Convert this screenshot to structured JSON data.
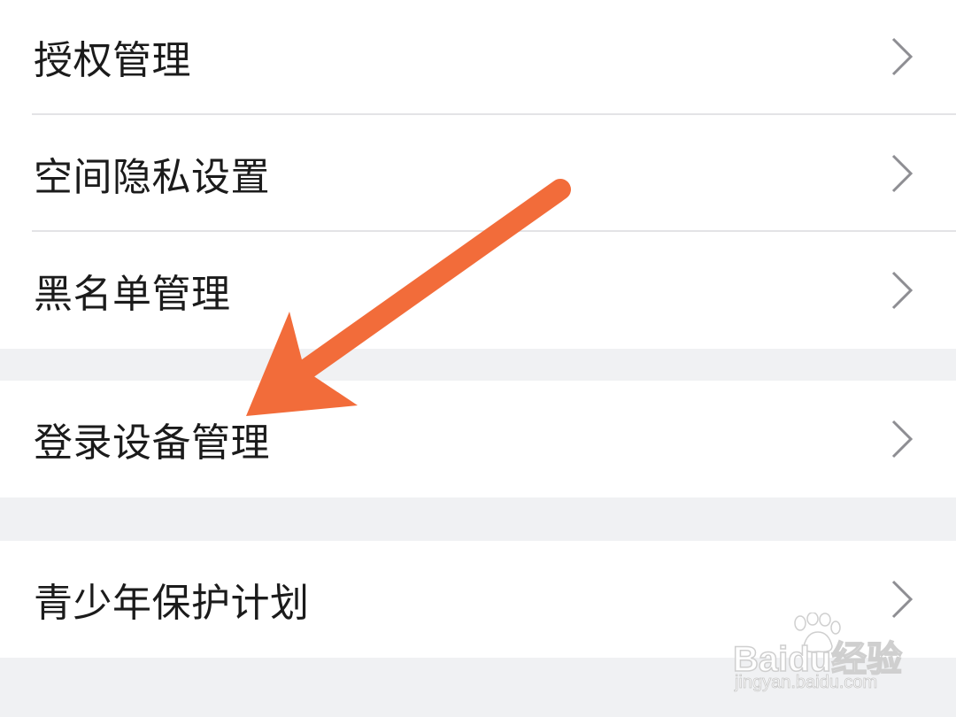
{
  "settings_groups": [
    {
      "items": [
        {
          "label": "授权管理"
        },
        {
          "label": "空间隐私设置"
        },
        {
          "label": "黑名单管理"
        }
      ]
    },
    {
      "items": [
        {
          "label": "登录设备管理"
        }
      ]
    },
    {
      "items": [
        {
          "label": "青少年保护计划"
        }
      ]
    }
  ],
  "colors": {
    "background": "#f0f1f3",
    "row_background": "#ffffff",
    "text": "#1b1b1b",
    "chevron": "#8e8e93",
    "divider": "#e3e3e6",
    "annotation_arrow": "#f26c3a"
  },
  "icons": {
    "row_chevron": "chevron-right-icon",
    "annotation": "arrow-annotation-icon"
  },
  "watermark": {
    "brand": "Baidu经验",
    "url": "jingyan.baidu.com"
  }
}
